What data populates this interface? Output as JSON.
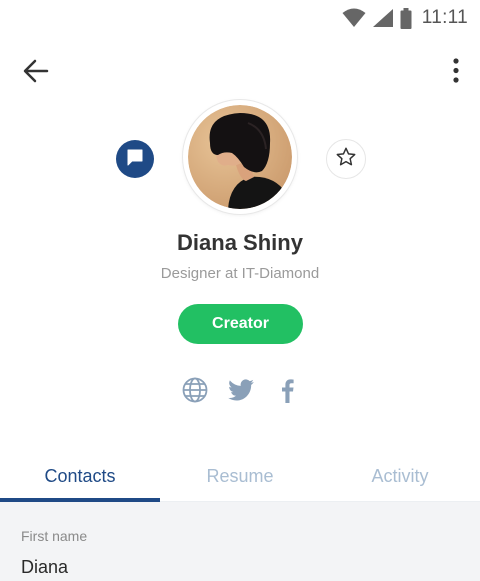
{
  "status_bar": {
    "time": "11:11",
    "icons": [
      "wifi-icon",
      "cellular-signal-icon",
      "battery-icon"
    ]
  },
  "app_bar": {
    "back_icon": "arrow-left-icon",
    "menu_icon": "more-vertical-icon"
  },
  "profile": {
    "name": "Diana Shiny",
    "subtitle": "Designer at IT-Diamond",
    "role_button_label": "Creator",
    "message_icon": "chat-bubble-icon",
    "favorite_icon": "star-outline-icon",
    "social_links": [
      "globe-icon",
      "twitter-icon",
      "facebook-icon"
    ]
  },
  "tabs": [
    {
      "label": "Contacts",
      "active": true
    },
    {
      "label": "Resume",
      "active": false
    },
    {
      "label": "Activity",
      "active": false
    }
  ],
  "contacts": {
    "first_name_label": "First name",
    "first_name_value": "Diana"
  },
  "colors": {
    "primary": "#1f4a86",
    "accent_green": "#22c063",
    "inactive_tab": "#a9bdd2",
    "social_icon": "#8aa0b8"
  }
}
